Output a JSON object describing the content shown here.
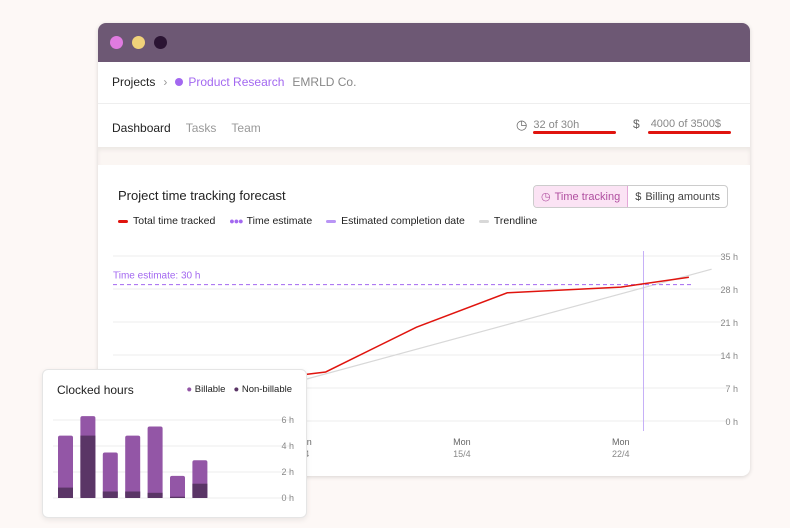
{
  "window": {
    "traffic_lights": [
      "#e07be0",
      "#f0d27a",
      "#2b1433"
    ],
    "titlebar_color": "#6d5874"
  },
  "breadcrumb": {
    "root": "Projects",
    "project": "Product Research",
    "client": "EMRLD Co."
  },
  "nav": {
    "tabs": [
      "Dashboard",
      "Tasks",
      "Team"
    ],
    "active": "Dashboard"
  },
  "stats": {
    "time": "32 of 30h",
    "billing": "4000 of 3500$"
  },
  "forecast": {
    "title": "Project time tracking forecast",
    "toggle": {
      "time": "Time tracking",
      "billing": "Billing amounts",
      "active": "time"
    },
    "legend": [
      "Total time tracked",
      "Time estimate",
      "Estimated completion date",
      "Trendline"
    ],
    "estimate_label": "Time estimate: 30 h"
  },
  "chart_data": [
    {
      "type": "line",
      "title": "Project time tracking forecast",
      "y_ticks": [
        "35 h",
        "28 h",
        "21 h",
        "14 h",
        "7 h",
        "0 h"
      ],
      "ylim": [
        0,
        35
      ],
      "x_ticks": [
        {
          "day": "Mon",
          "date": "8/4"
        },
        {
          "day": "Mon",
          "date": "15/4"
        },
        {
          "day": "Mon",
          "date": "22/4"
        }
      ],
      "series": [
        {
          "name": "Total time tracked",
          "color": "#e0140e",
          "points": [
            [
              "8/4",
              9.8
            ],
            [
              "9/4",
              10.4
            ],
            [
              "13/4",
              19.9
            ],
            [
              "17/4",
              27.2
            ],
            [
              "22/4",
              28.4
            ],
            [
              "25/4",
              30.5
            ]
          ]
        },
        {
          "name": "Trendline",
          "color": "#d8d8d8",
          "points": [
            [
              "8/4",
              8.7
            ],
            [
              "26/4",
              32.2
            ]
          ]
        }
      ],
      "time_estimate": 30,
      "estimated_completion_date": "23/4",
      "grid": true
    },
    {
      "type": "bar",
      "title": "Clocked hours",
      "stacked": true,
      "y_ticks": [
        "6 h",
        "4 h",
        "2 h",
        "0 h"
      ],
      "ylim": [
        0,
        6
      ],
      "series": [
        {
          "name": "Billable",
          "color": "#9356a6",
          "values": [
            4.0,
            1.5,
            3.0,
            4.3,
            5.1,
            1.6,
            1.8
          ]
        },
        {
          "name": "Non-billable",
          "color": "#5a3566",
          "values": [
            0.8,
            4.8,
            0.5,
            0.5,
            0.4,
            0.1,
            1.1
          ]
        }
      ]
    }
  ]
}
